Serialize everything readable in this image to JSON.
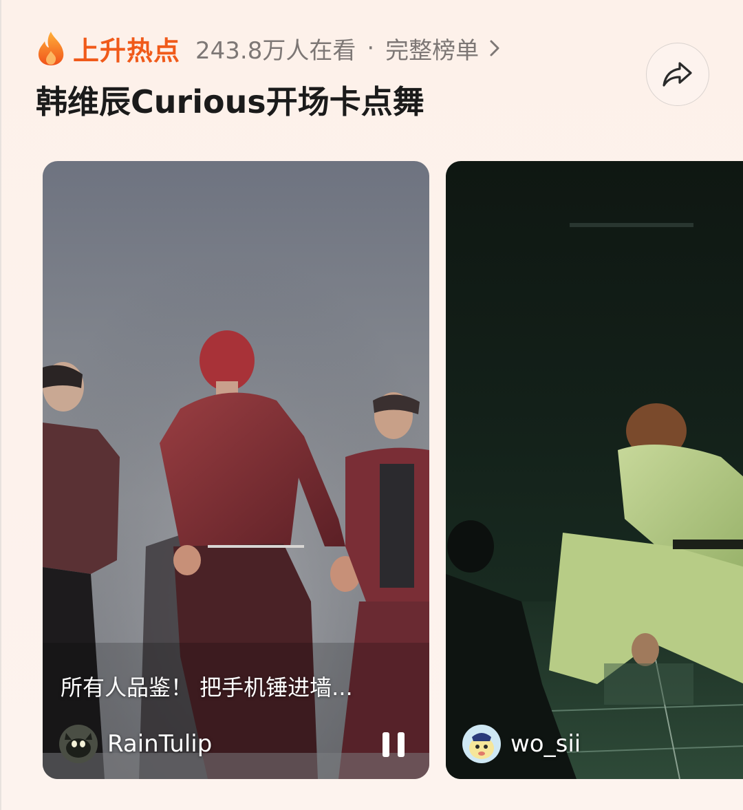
{
  "header": {
    "hot_label": "上升热点",
    "viewers": "243.8万人在看",
    "separator": "·",
    "full_list_label": "完整榜单"
  },
  "topic": {
    "title": "韩维辰Curious开场卡点舞"
  },
  "icons": {
    "flame": "flame-icon",
    "chevron": "chevron-right-icon",
    "share": "share-arrow-icon",
    "pause": "pause-icon"
  },
  "colors": {
    "accent": "#f05a1a",
    "background": "#fdf2ec",
    "muted_text": "#7d7775",
    "title_text": "#1b1b1b"
  },
  "videos": [
    {
      "caption": "所有人品鉴！ 把手机锤进墙...",
      "author": "RainTulip",
      "playing": true
    },
    {
      "caption": "",
      "author": "wo_sii",
      "playing": false
    }
  ]
}
